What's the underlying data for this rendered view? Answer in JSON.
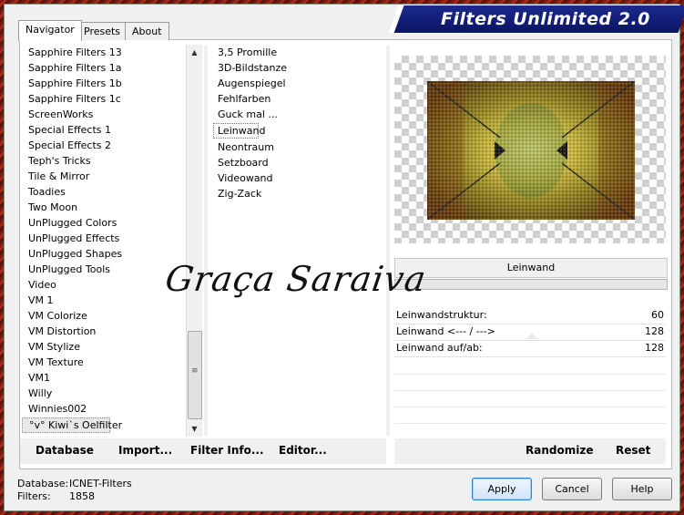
{
  "banner_title": "Filters Unlimited 2.0",
  "tabs": [
    {
      "label": "Navigator",
      "active": true
    },
    {
      "label": "Presets",
      "active": false
    },
    {
      "label": "About",
      "active": false
    }
  ],
  "categories": [
    "Sapphire Filters 13",
    "Sapphire Filters 1a",
    "Sapphire Filters 1b",
    "Sapphire Filters 1c",
    "ScreenWorks",
    "Special Effects 1",
    "Special Effects 2",
    "Teph's Tricks",
    "Tile & Mirror",
    "Toadies",
    "Two Moon",
    "UnPlugged Colors",
    "UnPlugged Effects",
    "UnPlugged Shapes",
    "UnPlugged Tools",
    "Video",
    "VM 1",
    "VM Colorize",
    "VM Distortion",
    "VM Stylize",
    "VM Texture",
    "VM1",
    "Willy",
    "Winnies002",
    "°v° Kiwi`s Oelfilter"
  ],
  "selected_category": "°v° Kiwi`s Oelfilter",
  "filters": [
    "3,5 Promille",
    "3D-Bildstanze",
    "Augenspiegel",
    "Fehlfarben",
    "Guck mal ...",
    "Leinwand",
    "Neontraum",
    "Setzboard",
    "Videowand",
    "Zig-Zack"
  ],
  "selected_filter": "Leinwand",
  "filter_name_display": "Leinwand",
  "params": [
    {
      "label": "Leinwandstruktur:",
      "value": "60"
    },
    {
      "label": "Leinwand <--- / --->",
      "value": "128"
    },
    {
      "label": "Leinwand auf/ab:",
      "value": "128"
    }
  ],
  "left_buttons": {
    "database": "Database",
    "import": "Import...",
    "filter_info": "Filter Info...",
    "editor": "Editor..."
  },
  "right_buttons": {
    "randomize": "Randomize",
    "reset": "Reset"
  },
  "status": {
    "database_label": "Database:",
    "database_value": "ICNET-Filters",
    "filters_label": "Filters:",
    "filters_value": "1858"
  },
  "dialog_buttons": {
    "apply": "Apply",
    "cancel": "Cancel",
    "help": "Help"
  },
  "watermark": "Graça Saraiva",
  "colors": {
    "banner": "#0b1566",
    "default_button_border": "#2f7fd6",
    "frame": "#7a1a12"
  }
}
